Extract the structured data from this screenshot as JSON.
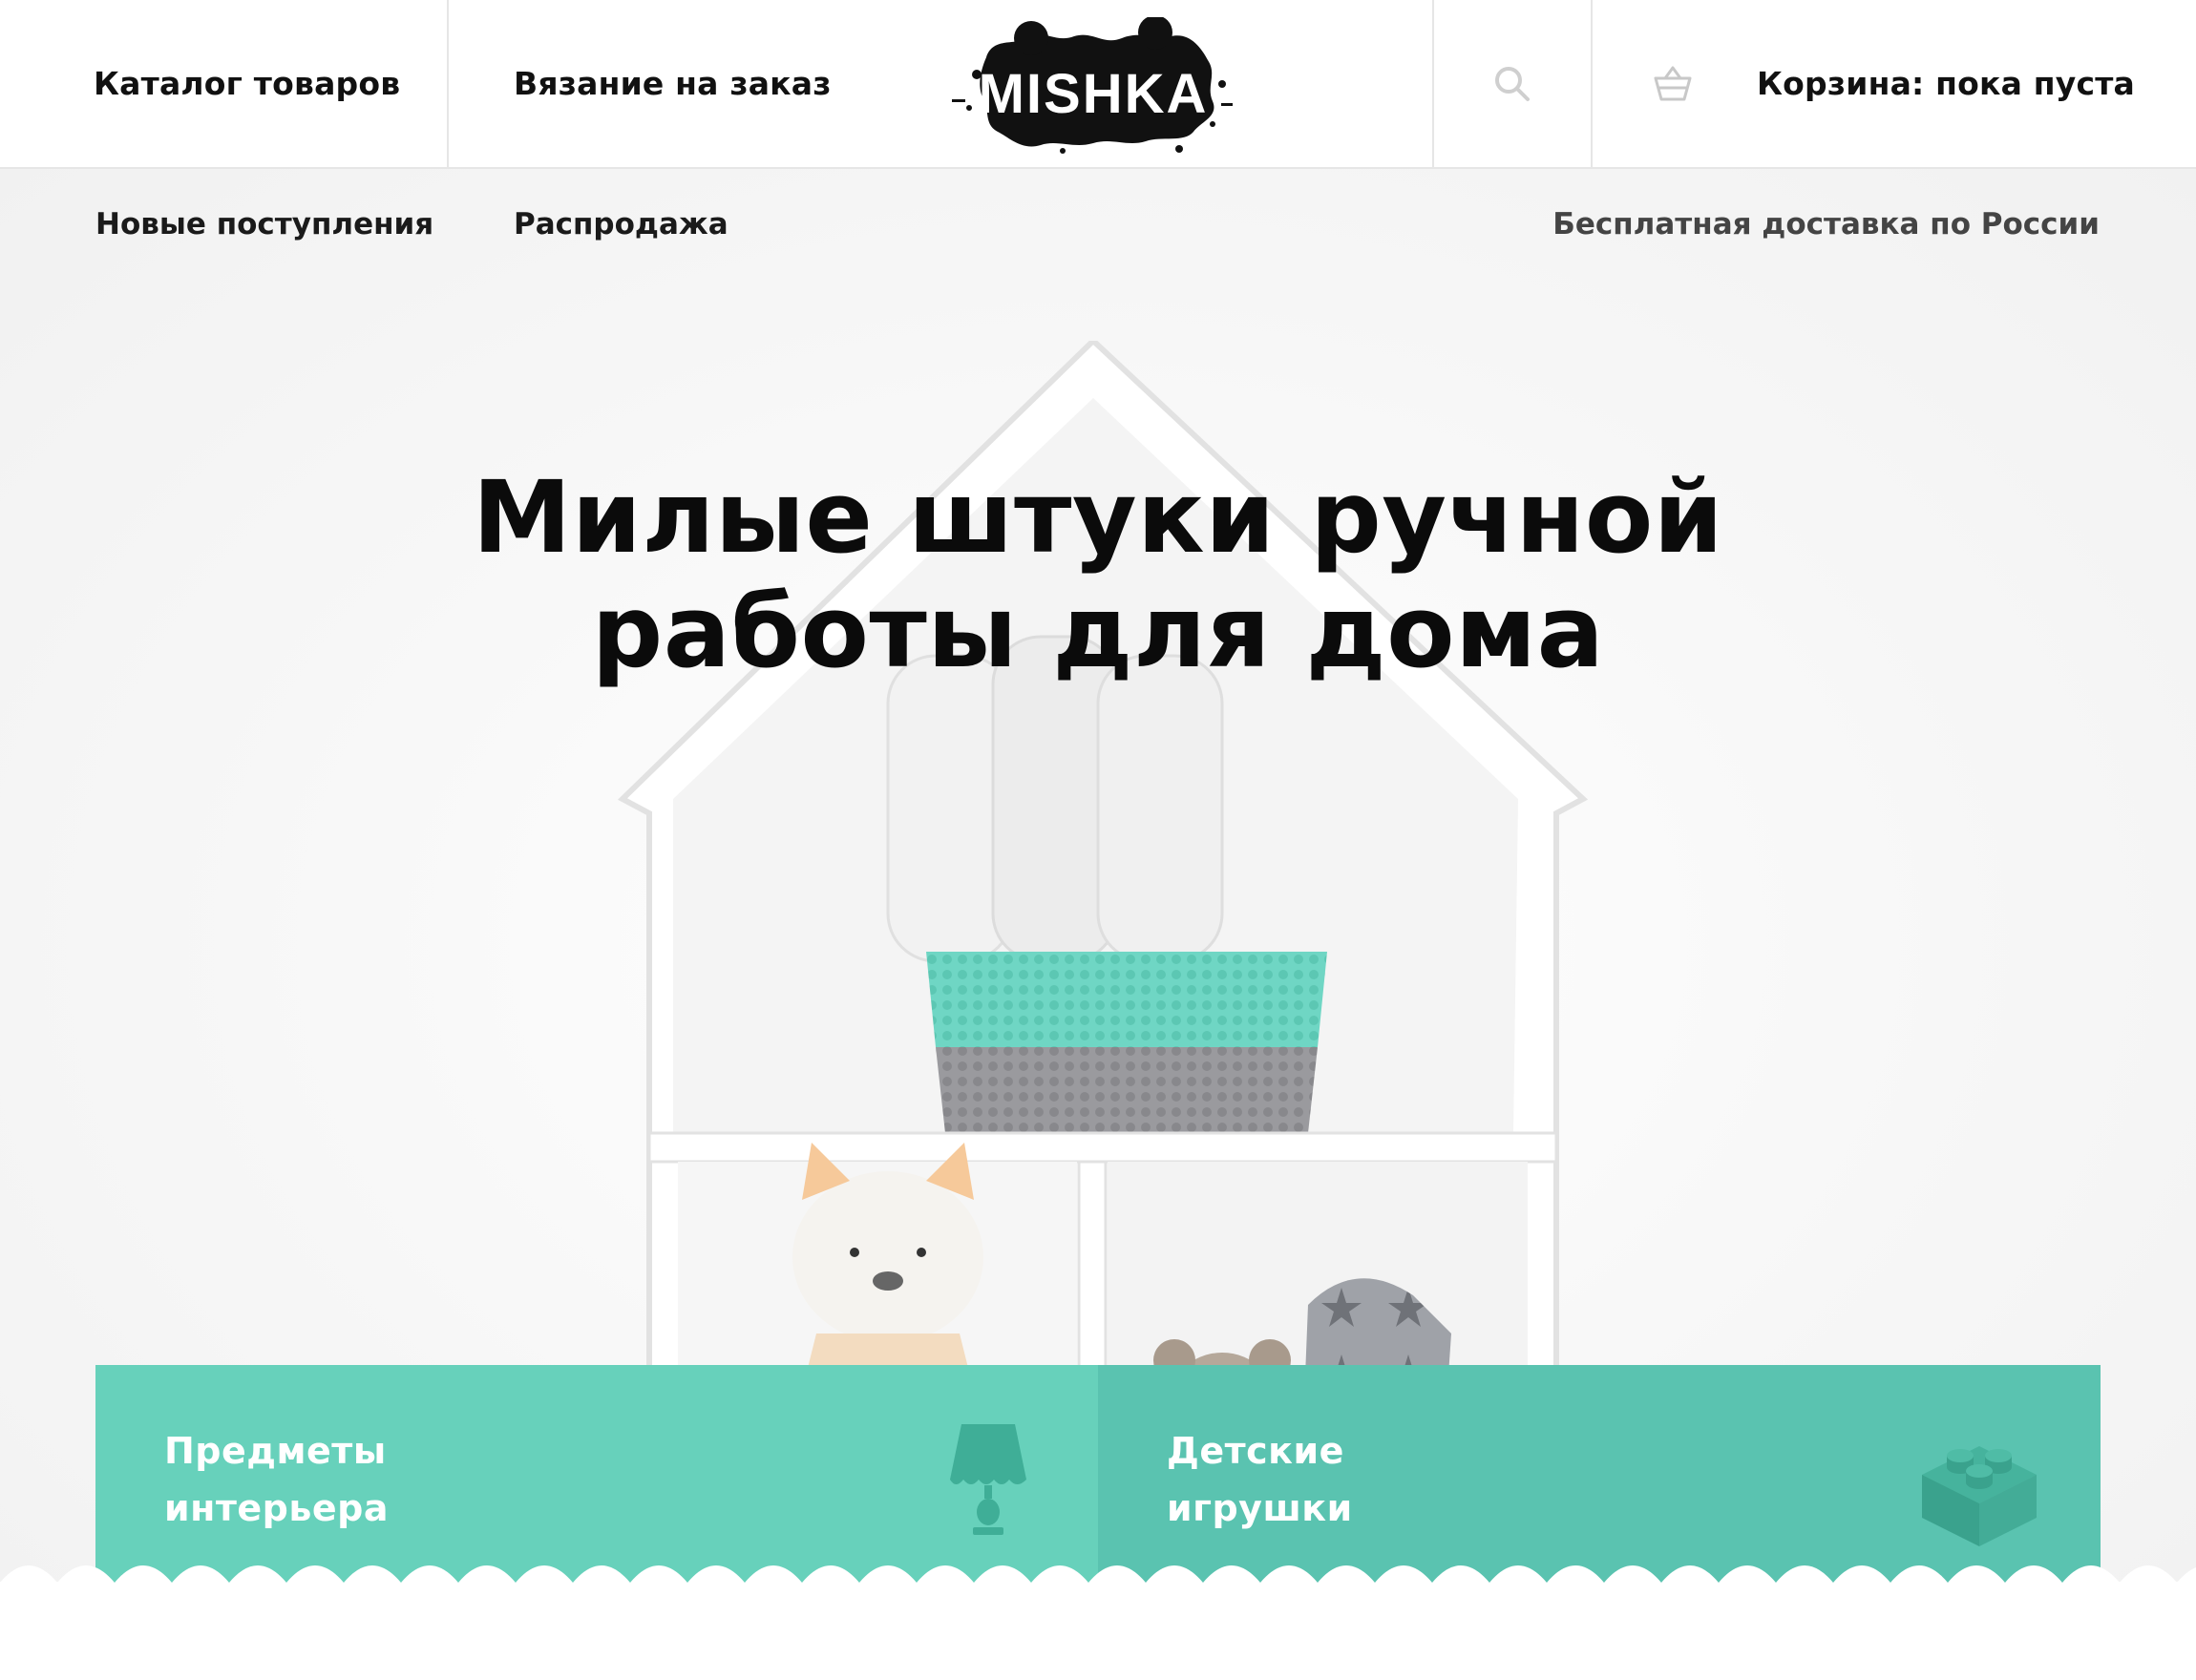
{
  "header": {
    "nav": [
      {
        "label": "Каталог товаров"
      },
      {
        "label": "Вязание на заказ"
      }
    ],
    "logo_text": "MISHKA",
    "cart_label": "Корзина: пока пуста"
  },
  "subnav": {
    "items": [
      {
        "label": "Новые поступления"
      },
      {
        "label": "Распродажа"
      }
    ],
    "delivery": "Бесплатная доставка по России"
  },
  "hero": {
    "title_line1": "Милые штуки ручной",
    "title_line2": "работы для дома"
  },
  "categories": [
    {
      "line1": "Предметы",
      "line2": "интерьера",
      "icon": "lamp-icon",
      "color": "#67d1bb"
    },
    {
      "line1": "Детские",
      "line2": "игрушки",
      "icon": "toy-block-icon",
      "color": "#5ac3b0"
    }
  ],
  "colors": {
    "accent": "#67d1bb",
    "accent_dark": "#5ac3b0",
    "text": "#111111",
    "divider": "#e6e6e6"
  }
}
